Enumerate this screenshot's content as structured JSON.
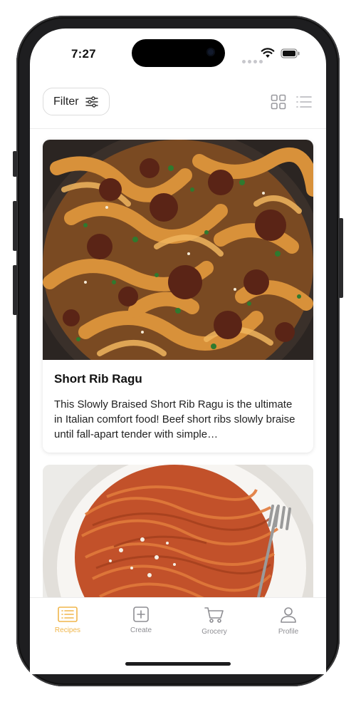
{
  "status_bar": {
    "time": "7:27"
  },
  "toolbar": {
    "filter_label": "Filter",
    "grid_view_icon": "grid-icon",
    "list_view_icon": "list-icon"
  },
  "recipes": [
    {
      "title": "Short Rib Ragu",
      "description": "This Slowly Braised Short Rib Ragu is the ultimate in Italian comfort food! Beef short ribs slowly braise until fall-apart tender with simple…",
      "image": "pappardelle-short-rib-photo"
    },
    {
      "image": "spaghetti-bolognese-photo"
    }
  ],
  "tabs": [
    {
      "label": "Recipes",
      "icon": "recipes-list-icon",
      "active": true
    },
    {
      "label": "Create",
      "icon": "plus-square-icon",
      "active": false
    },
    {
      "label": "Grocery",
      "icon": "cart-icon",
      "active": false
    },
    {
      "label": "Profile",
      "icon": "person-icon",
      "active": false
    }
  ],
  "colors": {
    "accent": "#f0b64b",
    "inactive": "#8e8e93",
    "frame": "#1e1e20"
  }
}
